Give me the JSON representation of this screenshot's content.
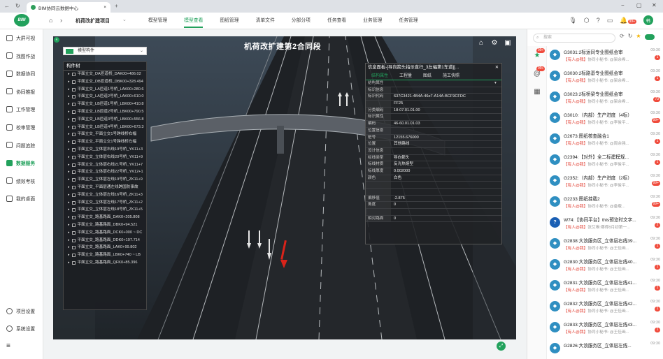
{
  "browser": {
    "tab_title": "BIM协同云数据中心",
    "tab_close": "×",
    "new_tab": "+"
  },
  "header": {
    "project": "机荷改扩建项目",
    "modules": [
      {
        "label": "模型管理",
        "active": false
      },
      {
        "label": "模型查看",
        "active": true
      },
      {
        "label": "图纸管理",
        "active": false
      },
      {
        "label": "清单文件",
        "active": false
      },
      {
        "label": "分部分项",
        "active": false
      },
      {
        "label": "任务查看",
        "active": false
      },
      {
        "label": "业务管理",
        "active": false
      },
      {
        "label": "任务管理",
        "active": false
      }
    ],
    "notify_badge": "99+",
    "avatar": "韩"
  },
  "sidenav": {
    "items": [
      {
        "label": "大屏可视",
        "active": false
      },
      {
        "label": "找图作战",
        "active": false
      },
      {
        "label": "数据协同",
        "active": false
      },
      {
        "label": "协同推报",
        "active": false
      },
      {
        "label": "工作管理",
        "active": false
      },
      {
        "label": "校审管理",
        "active": false
      },
      {
        "label": "问题追踪",
        "active": false
      },
      {
        "label": "数据服务",
        "active": true
      },
      {
        "label": "绩效考核",
        "active": false
      },
      {
        "label": "我的桌面",
        "active": false
      }
    ],
    "bottom": [
      {
        "label": "项目设置"
      },
      {
        "label": "系统设置"
      }
    ],
    "collapse": "≡"
  },
  "viewport": {
    "title": "机荷改扩建第2合同段",
    "tree_select": "模型构件",
    "tree_title": "构件树",
    "tree_rows": [
      "平面立交_DA匝道桥_DAK00+486.02",
      "平面立交_DB匝道桥_DBK00+328.494",
      "平面立交_LA匝道1号桥_LAK00+280.6",
      "平面立交_LA匝道2号桥_LAK00+610.0",
      "平面立交_LB匝道1号桥_LBK00+410.8",
      "平面立交_LB匝道2号桥_LBK00+790.5",
      "平面立交_LB匝道3号桥_LBK00+556.8",
      "平面立交_LB匝道4号桥_LBK00+673.3",
      "平面立交_平面立交1号跨线桥右幅",
      "平面立交_平面立交1号跨线桥左幅",
      "平面立交_立体层右线19号桥_YK11+3",
      "平面立交_立体层右线20号桥_YK11+9",
      "平面立交_立体层右线21号桥_YK11+7",
      "平面立交_立体层右线22号桥_YK12+1",
      "平面立交_立体层左线19号桥_ZK11+9",
      "平面立交_平面层通左线跨国防事故",
      "平面立交_立体层左线16号桥_ZK11+3",
      "平面立交_立体层左线17号桥_ZK11+2",
      "平面立交_立体层左线18号桥_ZK11+5",
      "平面立交_路基路面_DAK0+205.808",
      "平面立交_路基路面_DBK0+94.521",
      "平面立交_路基路面_DCK0+000 ~ DC",
      "平面立交_路基路面_DDK0+197.714",
      "平面立交_路基路面_LAK0+99.802",
      "平面立交_路基路面_LBK0+740 ~ LB",
      "平面立交_路基路面_QFK0+85.396"
    ],
    "info": {
      "title": "信息面板-[导向箭头指示直行_3左幅第1车道][...",
      "tabs": [
        "结构属性",
        "工程量",
        "图纸",
        "施工快照"
      ],
      "active_tab": 0,
      "section_label": "结构属性",
      "rows": [
        {
          "k": "标识信息",
          "v": ""
        },
        {
          "k": "标识代码",
          "v": "637C3421-4B4A-46e7-A14A-BCF9CFDC"
        },
        {
          "k": "",
          "v": "FF25"
        },
        {
          "k": "分类编码",
          "v": "18-07.01.01.00"
        },
        {
          "k": "标识属性",
          "v": ""
        },
        {
          "k": "编码",
          "v": "46-60.01.01.03"
        },
        {
          "k": "位置信息",
          "v": ""
        },
        {
          "k": "桩号",
          "v": "12155.676000"
        },
        {
          "k": "位置",
          "v": "其他路线"
        },
        {
          "k": "设计信息",
          "v": ""
        },
        {
          "k": "标线类型",
          "v": "导向箭头"
        },
        {
          "k": "标线材质",
          "v": "反光热熔型"
        },
        {
          "k": "标线厚度",
          "v": "0.002000"
        },
        {
          "k": "颜色",
          "v": "白色"
        },
        {
          "k": "",
          "v": ""
        },
        {
          "k": "",
          "v": ""
        },
        {
          "k": "偏移值",
          "v": "-2.875"
        },
        {
          "k": "角度",
          "v": "0"
        },
        {
          "k": "",
          "v": ""
        },
        {
          "k": "相对路面",
          "v": "0"
        }
      ]
    }
  },
  "chat": {
    "search_placeholder": "搜索",
    "rail_badges": [
      "99+",
      "99+"
    ],
    "messages": [
      {
        "title": "G3031:2标运同专业图纸会审",
        "mention": "【有人@我】",
        "sub": "协同小秘书: @架余希...",
        "time": "09:30",
        "count": "1"
      },
      {
        "title": "G3030:2标路基专业图纸会审",
        "mention": "【有人@我】",
        "sub": "协同小秘书: @架余希...",
        "time": "09:30",
        "count": "1"
      },
      {
        "title": "G3023:2标桥梁专业图纸会审",
        "mention": "【有人@我】",
        "sub": "协同小秘书: @架余希...",
        "time": "09:30",
        "count": "73"
      },
      {
        "title": "G3010:（内部）生产进度（4标）",
        "mention": "【有人@我】",
        "sub": "协同小秘书: @李俊平...",
        "time": "09:30",
        "count": "99+"
      },
      {
        "title": "G2673:图纸核查融合1",
        "mention": "【有人@我】",
        "sub": "协同小秘书: @周余强...",
        "time": "09:30",
        "count": "1"
      },
      {
        "title": "G2394:【对外】全二标建模规...",
        "mention": "【有人@我】",
        "sub": "协同小秘书: @李俊平...",
        "time": "09:30",
        "count": "1"
      },
      {
        "title": "G2352:（内部）生产进度（2标）",
        "mention": "【有人@我】",
        "sub": "协同小秘书: @李俊平...",
        "time": "09:30",
        "count": "99+"
      },
      {
        "title": "G2233:图纸挂载2",
        "mention": "【有人@我】",
        "sub": "协同小秘书: @备载...",
        "time": "09:30",
        "count": "99+"
      },
      {
        "title": "W74:【协同平台】this预览时文字...",
        "mention": "【有人@我】",
        "sub": "张艾琳:哪得8月初第一...",
        "time": "09:30",
        "count": "2"
      },
      {
        "title": "G2838:大浪服务区_立体层右线39...",
        "mention": "【有人@我】",
        "sub": "协同小秘书: @王佳画...",
        "time": "09:30",
        "count": "1"
      },
      {
        "title": "G2830:大浪服务区_立体层左线40...",
        "mention": "【有人@我】",
        "sub": "协同小秘书: @王佳画...",
        "time": "09:30",
        "count": "1"
      },
      {
        "title": "G2831:大浪服务区_立体层左线41...",
        "mention": "【有人@我】",
        "sub": "协同小秘书: @王佳画...",
        "time": "09:30",
        "count": "1"
      },
      {
        "title": "G2832:大浪服务区_立体层左线42...",
        "mention": "【有人@我】",
        "sub": "协同小秘书: @王佳画...",
        "time": "09:30",
        "count": "1"
      },
      {
        "title": "G2833:大浪服务区_立体层左线43...",
        "mention": "【有人@我】",
        "sub": "协同小秘书: @王佳画...",
        "time": "09:30",
        "count": "1"
      },
      {
        "title": "G2826:大浪服务区_立体层左线...",
        "mention": "",
        "sub": "",
        "time": "09:30",
        "count": ""
      }
    ]
  },
  "colors": {
    "accent": "#22a15c",
    "badge": "#f04b3c",
    "dark_panel": "#1c1e22"
  }
}
